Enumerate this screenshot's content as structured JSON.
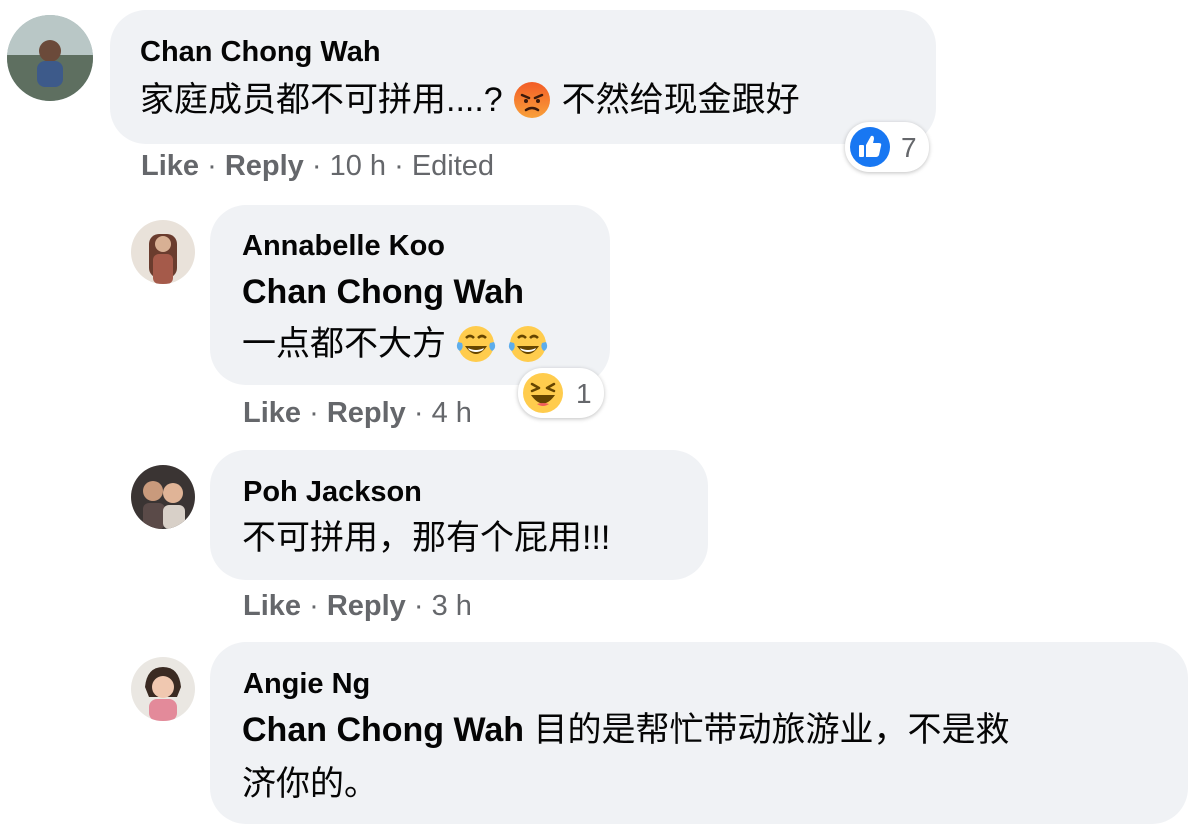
{
  "comments": [
    {
      "author": "Chan Chong Wah",
      "text_before": "家庭成员都不可拼用....?",
      "emoji_name": "angry-face-icon",
      "text_after": "不然给现金跟好",
      "reaction": {
        "icon": "like-icon",
        "count": "7"
      },
      "actions": {
        "like": "Like",
        "reply": "Reply",
        "time": "10 h",
        "edited": "Edited"
      }
    },
    {
      "author": "Annabelle Koo",
      "mention": "Chan Chong Wah",
      "text": "一点都不大方",
      "emojis": [
        "tears-of-joy-icon",
        "tears-of-joy-icon"
      ],
      "reaction": {
        "icon": "haha-icon",
        "count": "1"
      },
      "actions": {
        "like": "Like",
        "reply": "Reply",
        "time": "4 h"
      }
    },
    {
      "author": "Poh Jackson",
      "text": "不可拼用，那有个屁用!!!",
      "actions": {
        "like": "Like",
        "reply": "Reply",
        "time": "3 h"
      }
    },
    {
      "author": "Angie Ng",
      "mention": "Chan Chong Wah",
      "text_line1": "目的是帮忙带动旅游业，不是救",
      "text_line2": "济你的。"
    }
  ],
  "colors": {
    "bubble": "#f0f2f5",
    "meta": "#65676b",
    "like_blue": "#1877f2",
    "emoji_yellow": "#ffcc4d",
    "angry_orange": "#f25c26"
  }
}
